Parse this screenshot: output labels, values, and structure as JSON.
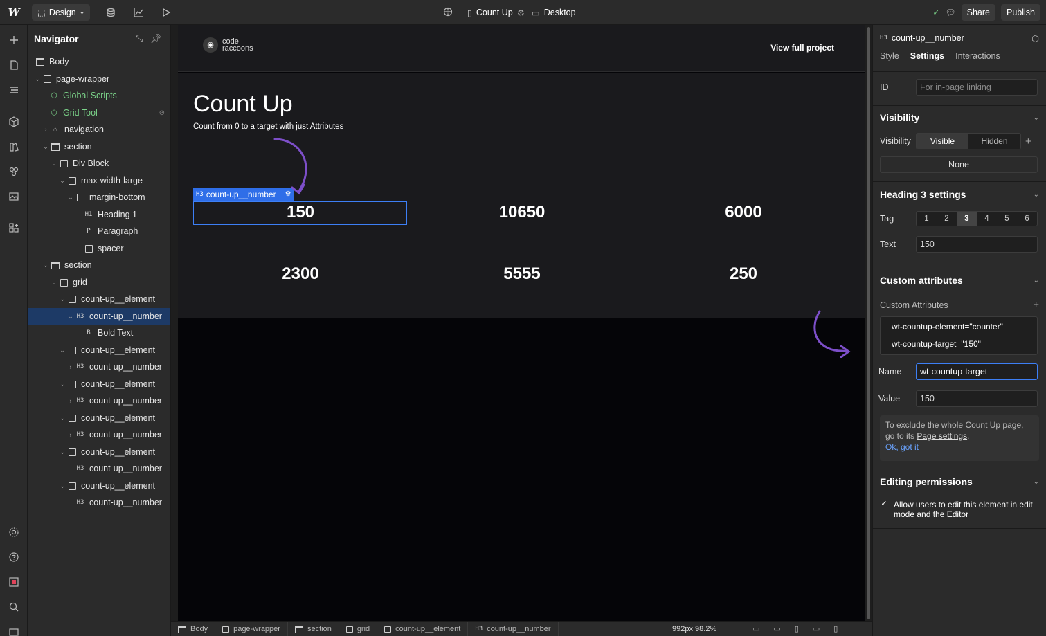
{
  "topbar": {
    "logo": "W",
    "mode_label": "Design",
    "page_name": "Count Up",
    "breakpoint_label": "Desktop",
    "share_label": "Share",
    "publish_label": "Publish"
  },
  "navigator": {
    "title": "Navigator",
    "items": [
      {
        "label": "Body"
      },
      {
        "label": "page-wrapper"
      },
      {
        "label": "Global Scripts"
      },
      {
        "label": "Grid Tool"
      },
      {
        "label": "navigation"
      },
      {
        "label": "section"
      },
      {
        "label": "Div Block"
      },
      {
        "label": "max-width-large"
      },
      {
        "label": "margin-bottom"
      },
      {
        "label": "Heading 1"
      },
      {
        "label": "Paragraph"
      },
      {
        "label": "spacer"
      },
      {
        "label": "section"
      },
      {
        "label": "grid"
      },
      {
        "label": "count-up__element"
      },
      {
        "label": "count-up__number"
      },
      {
        "label": "Bold Text"
      },
      {
        "label": "count-up__element"
      },
      {
        "label": "count-up__number"
      },
      {
        "label": "count-up__element"
      },
      {
        "label": "count-up__number"
      },
      {
        "label": "count-up__element"
      },
      {
        "label": "count-up__number"
      },
      {
        "label": "count-up__element"
      },
      {
        "label": "count-up__number"
      },
      {
        "label": "count-up__element"
      },
      {
        "label": "count-up__number"
      }
    ],
    "tags": {
      "h1": "H1",
      "p": "P",
      "h3": "H3",
      "b": "B"
    }
  },
  "canvas": {
    "logo_line1": "code",
    "logo_line2": "raccoons",
    "view_link": "View full project",
    "title": "Count Up",
    "subtitle": "Count from 0 to a target with just Attributes",
    "selected_label": "count-up__number",
    "numbers": [
      "150",
      "10650",
      "6000",
      "2300",
      "5555",
      "250"
    ]
  },
  "bottombar": {
    "crumbs": [
      "Body",
      "page-wrapper",
      "section",
      "grid",
      "count-up__element",
      "count-up__number"
    ],
    "zoom": "992px 98.2%"
  },
  "rpanel": {
    "element_name": "count-up__number",
    "tabs": [
      "Style",
      "Settings",
      "Interactions"
    ],
    "id_label": "ID",
    "id_placeholder": "For in-page linking",
    "visibility_title": "Visibility",
    "visibility_label": "Visibility",
    "visible_option": "Visible",
    "hidden_option": "Hidden",
    "none_label": "None",
    "heading_title": "Heading 3 settings",
    "tag_label": "Tag",
    "tag_options": [
      "1",
      "2",
      "3",
      "4",
      "5",
      "6"
    ],
    "text_label": "Text",
    "text_value": "150",
    "custom_title": "Custom attributes",
    "custom_label": "Custom Attributes",
    "attributes": [
      "wt-countup-element=\"counter\"",
      "wt-countup-target=\"150\""
    ],
    "name_label": "Name",
    "name_value": "wt-countup-target",
    "value_label": "Value",
    "value_value": "150",
    "tip_text": "To exclude the whole Count Up page, go to its",
    "tip_link": "Page settings",
    "tip_ok": "Ok, got it",
    "editing_title": "Editing permissions",
    "editing_check": "Allow users to edit this element in edit mode and the Editor"
  },
  "colors": {
    "accent": "#3d7ff5",
    "panel": "#2b2b2b",
    "canvas": "#050508",
    "arrow": "#7d4fc9"
  }
}
